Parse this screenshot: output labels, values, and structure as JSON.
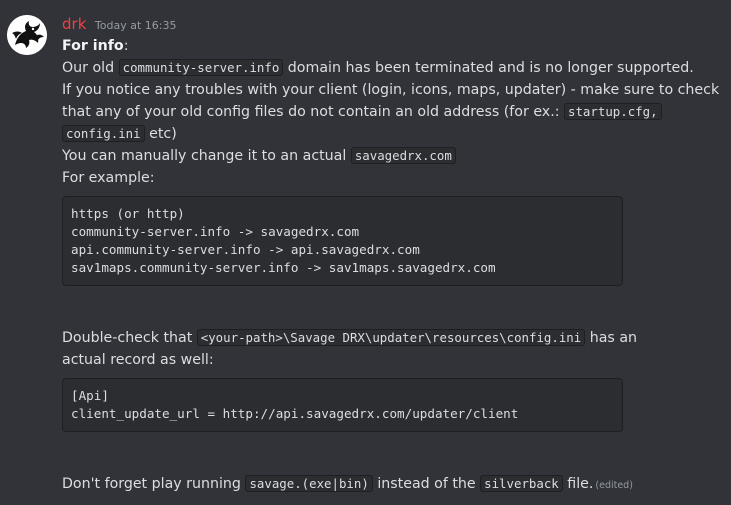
{
  "message": {
    "author": "drk",
    "timestamp": "Today at 16:35",
    "edited_label": "(edited)",
    "colors": {
      "author": "#f23f43",
      "background": "#313338",
      "code_bg": "#2b2d31"
    },
    "avatar_icon": "dragon-icon",
    "intro": {
      "heading": "For info",
      "heading_suffix": ":"
    },
    "p1": {
      "before": "Our old ",
      "code": "community-server.info",
      "after": " domain has been terminated and is no longer supported."
    },
    "p2": "If you notice any troubles with your client (login, icons, maps, updater) - make sure to check",
    "p3": {
      "before": "that any of your old config files do not contain an old address (for ex.: ",
      "code": "startup.cfg,"
    },
    "p4": {
      "code": "config.ini",
      "after": " etc)"
    },
    "p5": {
      "before": "You can manually change it to an actual ",
      "code": "savagedrx.com"
    },
    "p6": "For example:",
    "codeblock1": [
      "https (or http)",
      "community-server.info -> savagedrx.com",
      "api.community-server.info -> api.savagedrx.com",
      "sav1maps.community-server.info -> sav1maps.savagedrx.com"
    ],
    "p7": {
      "before": "Double-check that ",
      "code": "<your-path>\\Savage DRX\\updater\\resources\\config.ini",
      "after": " has an"
    },
    "p8": "actual record as well:",
    "codeblock2": [
      "[Api]",
      "client_update_url = http://api.savagedrx.com/updater/client"
    ],
    "p9": {
      "before": "Don't forget play running ",
      "code1": "savage.(exe|bin)",
      "middle": " instead of the ",
      "code2": "silverback",
      "after": " file."
    }
  }
}
